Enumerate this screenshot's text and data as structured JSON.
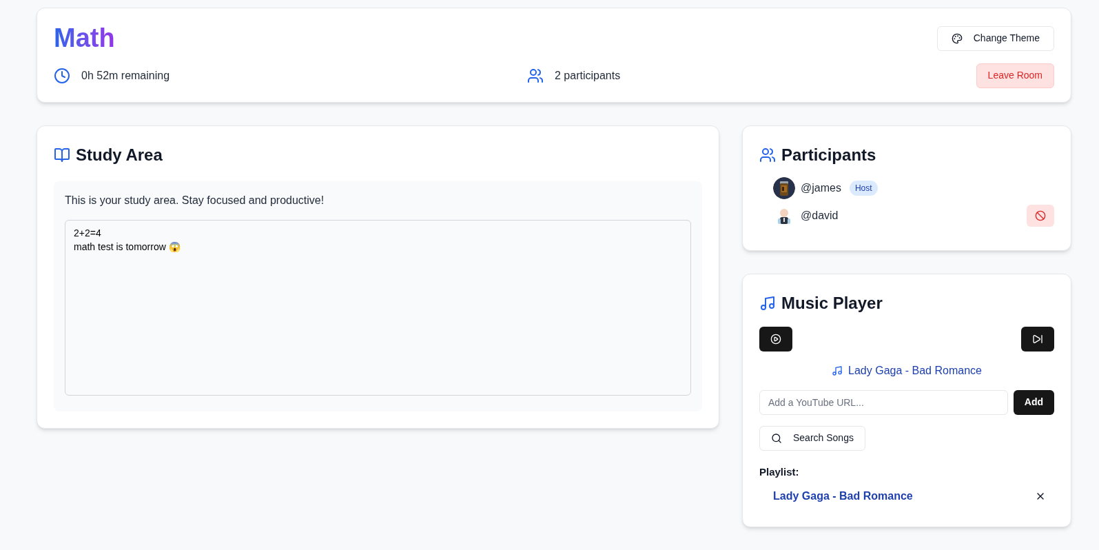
{
  "header": {
    "title": "Math",
    "theme_button": "Change Theme",
    "time_remaining": "0h 52m remaining",
    "participant_count": "2 participants",
    "leave_button": "Leave Room"
  },
  "study_area": {
    "title": "Study Area",
    "intro": "This is your study area. Stay focused and productive!",
    "notes": "2+2=4\nmath test is tomorrow 😱"
  },
  "participants": {
    "title": "Participants",
    "items": [
      {
        "name": "@james",
        "badge": "Host",
        "can_remove": false
      },
      {
        "name": "@david",
        "can_remove": true
      }
    ]
  },
  "music_player": {
    "title": "Music Player",
    "now_playing": "Lady Gaga - Bad Romance",
    "url_placeholder": "Add a YouTube URL...",
    "add_button": "Add",
    "search_button": "Search Songs",
    "playlist_label": "Playlist:",
    "playlist": [
      {
        "title": "Lady Gaga - Bad Romance"
      }
    ]
  }
}
